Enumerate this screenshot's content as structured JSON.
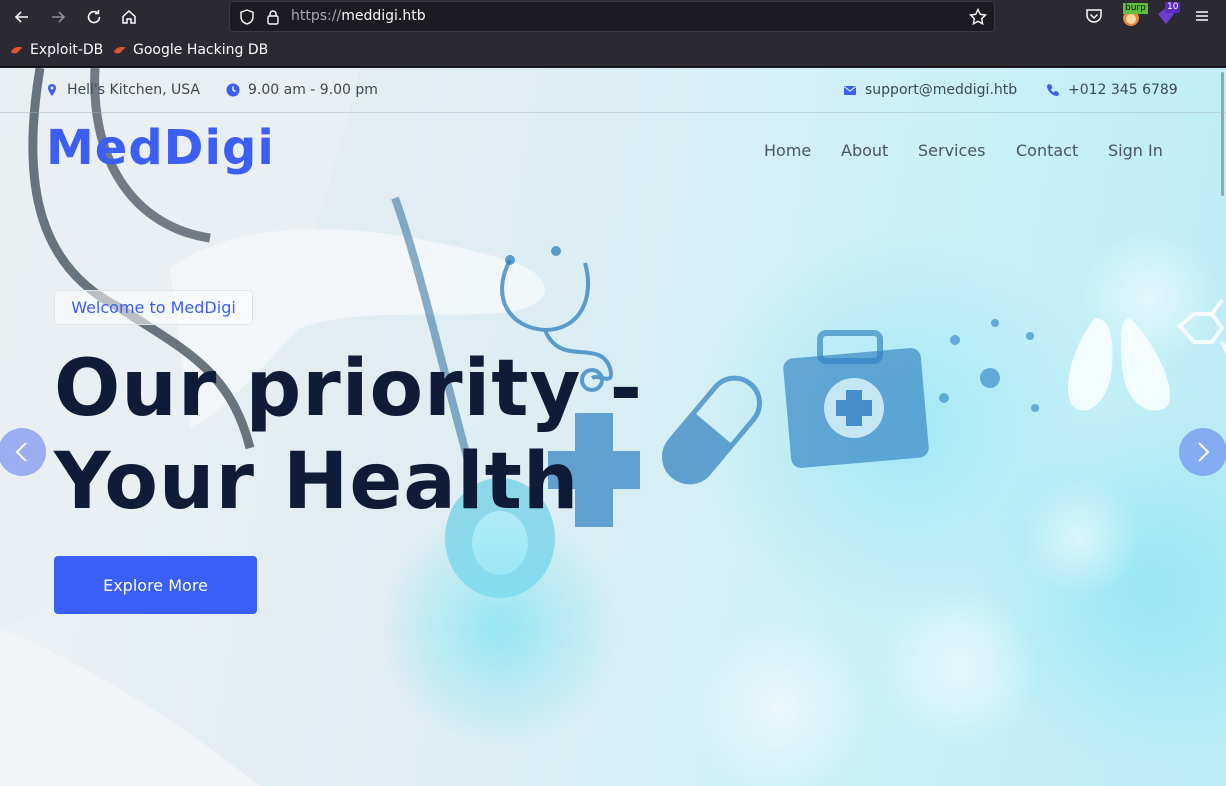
{
  "browser": {
    "url_scheme": "https://",
    "url_host": "meddigi.htb",
    "bookmarks": [
      "Exploit-DB",
      "Google Hacking DB"
    ],
    "extensions": {
      "burp_label": "burp",
      "badge_count": "10"
    }
  },
  "topbar": {
    "location": "Hell's Kitchen, USA",
    "hours": "9.00 am - 9.00 pm",
    "email": "support@meddigi.htb",
    "phone": "+012 345 6789"
  },
  "brand": "MedDigi",
  "nav": [
    "Home",
    "About",
    "Services",
    "Contact",
    "Sign In"
  ],
  "hero": {
    "welcome": "Welcome to MedDigi",
    "title_line1": "Our priority -",
    "title_line2": "Your Health",
    "cta": "Explore More"
  },
  "colors": {
    "accent": "#3a5ff7",
    "brand": "#3d5ef2",
    "title": "#0e1c38"
  }
}
